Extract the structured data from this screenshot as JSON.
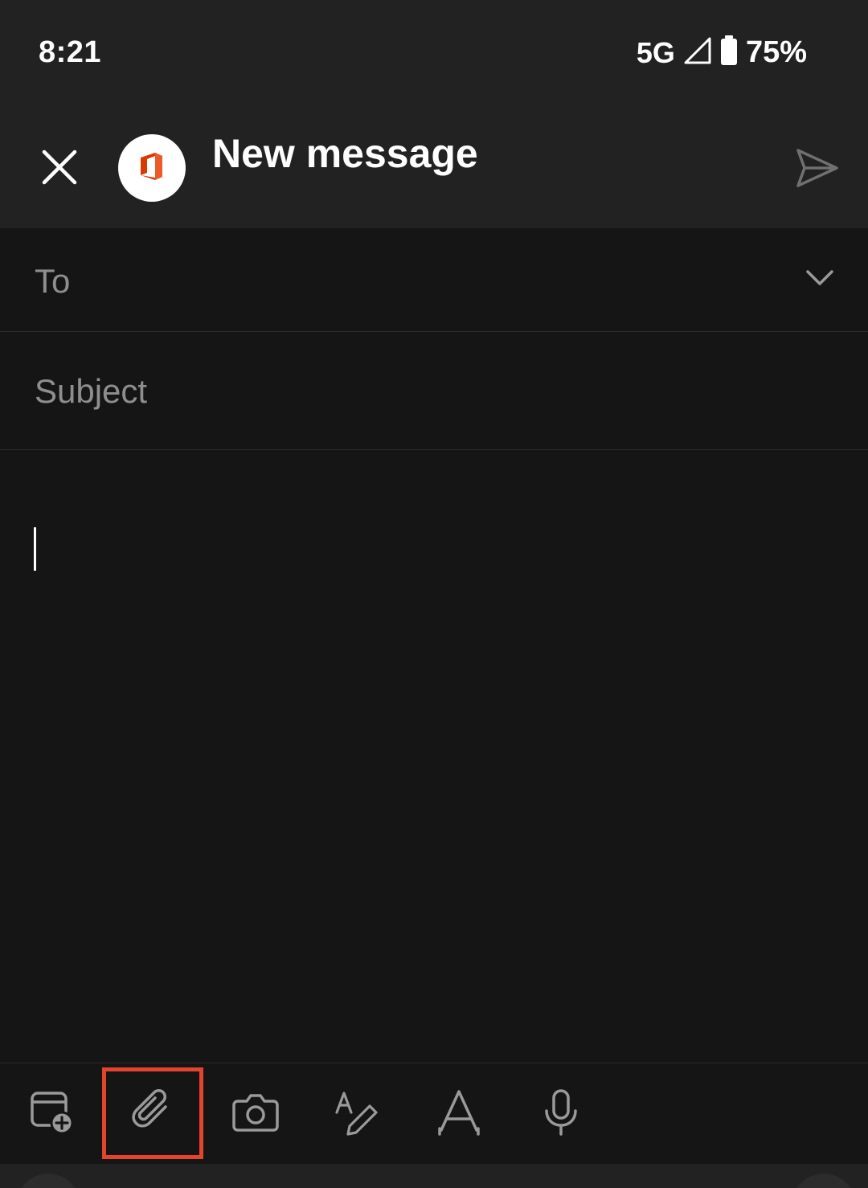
{
  "status_bar": {
    "time": "8:21",
    "network": "5G",
    "battery_percent": "75%",
    "battery_level": 0.75,
    "icons": [
      "signal-icon",
      "battery-icon"
    ]
  },
  "app_bar": {
    "title": "New message",
    "close_icon": "close-icon",
    "avatar_icon": "office-logo-icon",
    "send_icon": "send-icon"
  },
  "compose": {
    "to_placeholder": "To",
    "subject_placeholder": "Subject",
    "body_value": ""
  },
  "toolbar": {
    "items": [
      {
        "name": "calendar-add",
        "icon": "calendar-add-icon"
      },
      {
        "name": "attach",
        "icon": "paperclip-icon",
        "highlighted": true
      },
      {
        "name": "camera",
        "icon": "camera-icon"
      },
      {
        "name": "ink",
        "icon": "ink-pen-icon"
      },
      {
        "name": "format-text",
        "icon": "text-format-icon"
      },
      {
        "name": "dictate",
        "icon": "microphone-icon"
      }
    ]
  },
  "colors": {
    "background": "#151515",
    "app_bar": "#222222",
    "placeholder": "#8e8e8e",
    "icon": "#9a9a9a",
    "highlight": "#e3442b",
    "office_red": "#d83b01"
  }
}
